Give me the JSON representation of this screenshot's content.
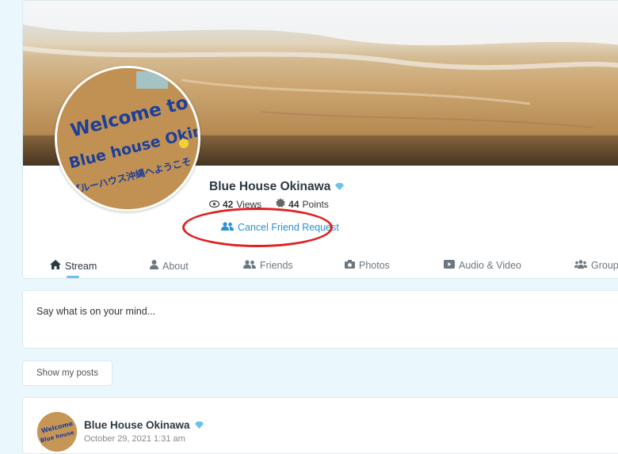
{
  "profile": {
    "name": "Blue House Okinawa",
    "views_count": "42",
    "views_label": "Views",
    "points_count": "44",
    "points_label": "Points",
    "cancel_request_label": "Cancel Friend Request",
    "avatar_sign_text": [
      "Welcome to",
      "Blue house Okinawa",
      "ブルーハウス沖縄へようこそ"
    ]
  },
  "tabs": [
    {
      "label": "Stream",
      "icon": "home-icon"
    },
    {
      "label": "About",
      "icon": "user-icon"
    },
    {
      "label": "Friends",
      "icon": "users-icon"
    },
    {
      "label": "Photos",
      "icon": "camera-icon"
    },
    {
      "label": "Audio & Video",
      "icon": "video-icon"
    },
    {
      "label": "Groups",
      "icon": "group-icon"
    }
  ],
  "composer": {
    "placeholder": "Say what is on your mind..."
  },
  "filter": {
    "show_my_posts_label": "Show my posts"
  },
  "post": {
    "author": "Blue House Okinawa",
    "date": "October 29, 2021 1:31 am"
  },
  "colors": {
    "accent": "#2a8fd4",
    "highlight": "#e02020",
    "verified": "#6bc2ea",
    "background": "#eaf8fd"
  }
}
